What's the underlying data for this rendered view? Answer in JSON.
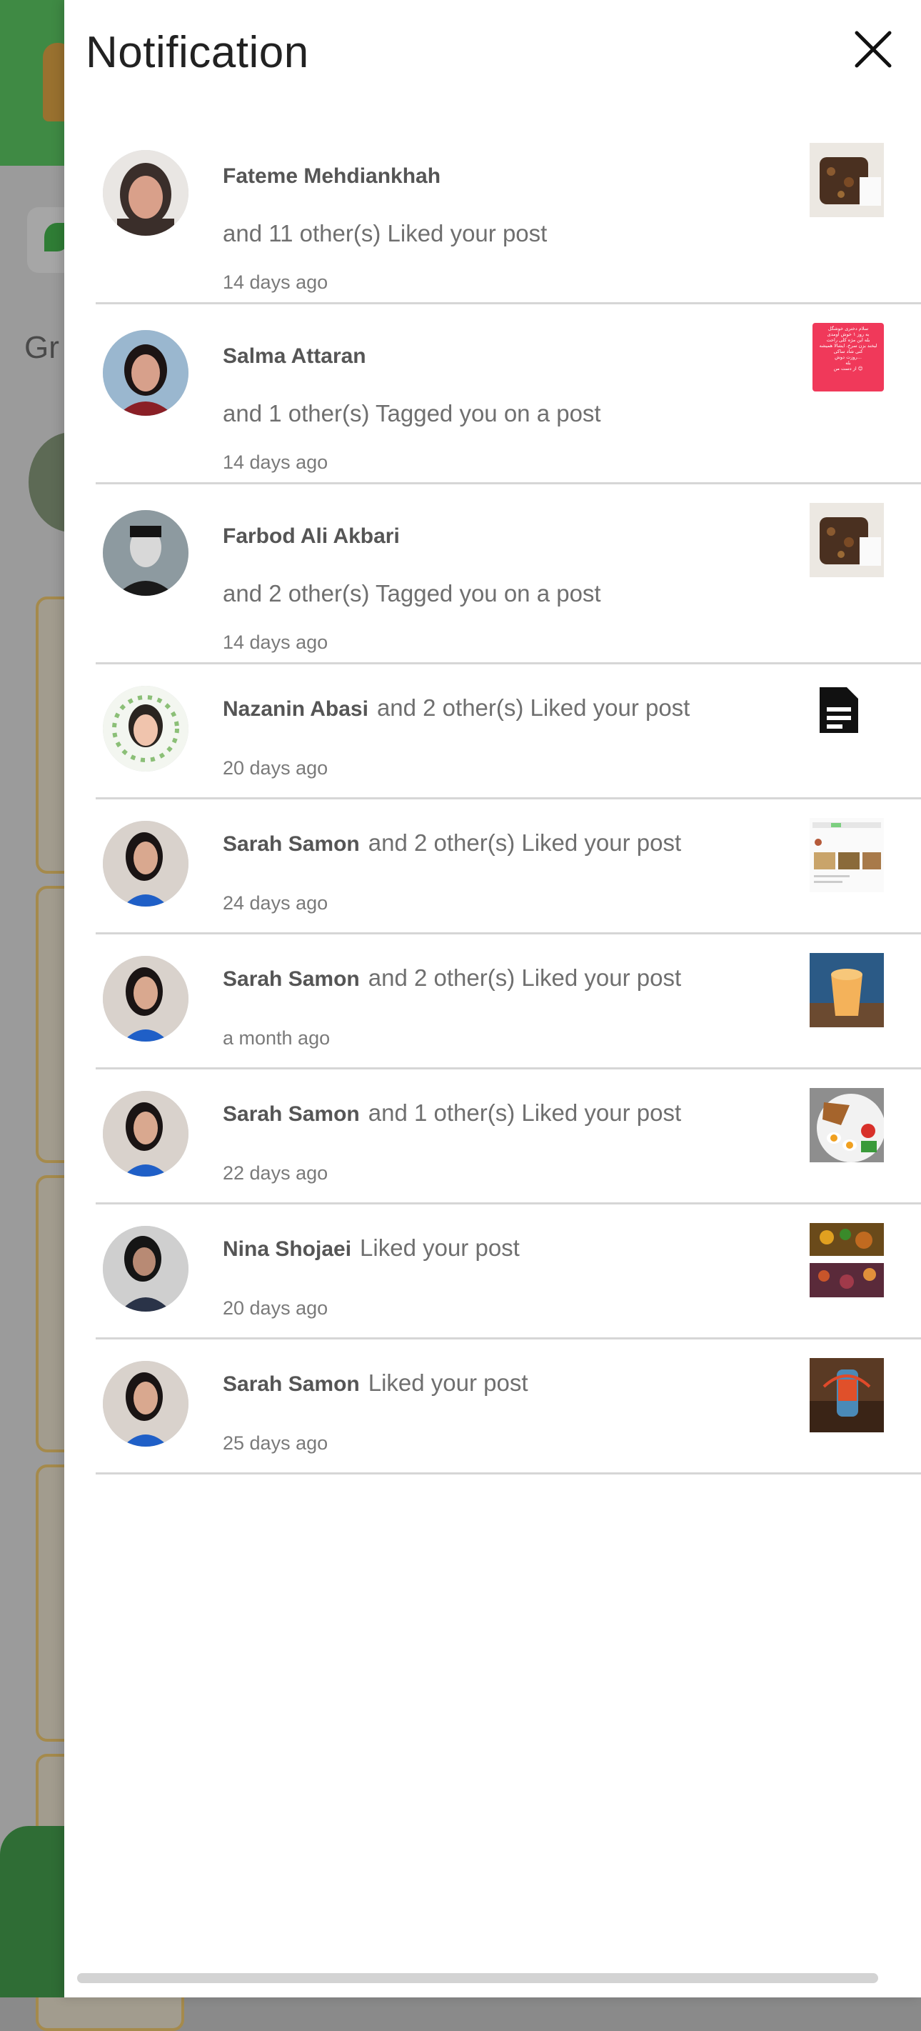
{
  "drawer": {
    "title": "Notification"
  },
  "background": {
    "title_fragment": "Gr"
  },
  "notifications": [
    {
      "name": "Fateme Mehdiankhah",
      "action": "and 11 other(s) Liked your post",
      "time": "14 days ago",
      "thumb": "food-photo"
    },
    {
      "name": "Salma Attaran",
      "action": "and 1 other(s) Tagged you on a post",
      "time": "14 days ago",
      "thumb": "persian-text-image",
      "thumb_text": [
        "سلام دختری خوشگل",
        "به روز ۱ خوش اومدی",
        "بله این مژه کلی راحت",
        "لبخند بزن سرخ، ایشالا همیشه",
        "کنی شاد ساکی",
        "روزت دوش...",
        "بله",
        "از دست من 😊"
      ]
    },
    {
      "name": "Farbod Ali Akbari",
      "action": "and 2 other(s) Tagged you on a post",
      "time": "14 days ago",
      "thumb": "food-photo"
    },
    {
      "name": "Nazanin Abasi",
      "action": "and 2 other(s) Liked your post",
      "time": "20 days ago",
      "thumb": "document-icon"
    },
    {
      "name": "Sarah Samon",
      "action": "and 2 other(s) Liked your post",
      "time": "24 days ago",
      "thumb": "screenshot"
    },
    {
      "name": "Sarah Samon",
      "action": "and 2 other(s) Liked your post",
      "time": "a month ago",
      "thumb": "smoothie-photo"
    },
    {
      "name": "Sarah Samon",
      "action": "and 1 other(s) Liked your post",
      "time": "22 days ago",
      "thumb": "plate-photo"
    },
    {
      "name": "Nina Shojaei",
      "action": "Liked your post",
      "time": "20 days ago",
      "thumb": "dish-photo"
    },
    {
      "name": "Sarah Samon",
      "action": "Liked your post",
      "time": "25 days ago",
      "thumb": "bottle-photo"
    }
  ],
  "colors": {
    "accent_green": "#3f8a44",
    "divider": "#d6d6d6",
    "name_text": "#555555",
    "body_text": "#6f6f6f"
  }
}
